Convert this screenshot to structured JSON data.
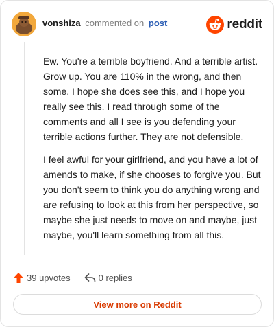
{
  "header": {
    "username": "vonshiza",
    "action": "commented on",
    "post_link": "post",
    "logo_text": "reddit"
  },
  "comment": {
    "paragraphs": [
      "Ew. You're a terrible boyfriend. And a terrible artist. Grow up. You are 110% in the wrong, and then some. I hope she does see this, and I hope you really see this. I read through some of the comments and all I see is you defending your terrible actions further. They are not defensible.",
      "I feel awful for your girlfriend, and you have a lot of amends to make, if she chooses to forgive you. But you don't seem to think you do anything wrong and are refusing to look at this from her perspective, so maybe she just needs to move on and maybe, just maybe, you'll learn something from all this."
    ]
  },
  "footer": {
    "upvotes": "39 upvotes",
    "replies": "0 replies"
  },
  "view_more_label": "View more on Reddit",
  "colors": {
    "brand_orange": "#ff4500",
    "link_blue": "#2b5db4",
    "button_text": "#d93a00"
  },
  "icons": [
    "avatar",
    "reddit-logo-icon",
    "upvote-arrow-icon",
    "reply-icon"
  ]
}
